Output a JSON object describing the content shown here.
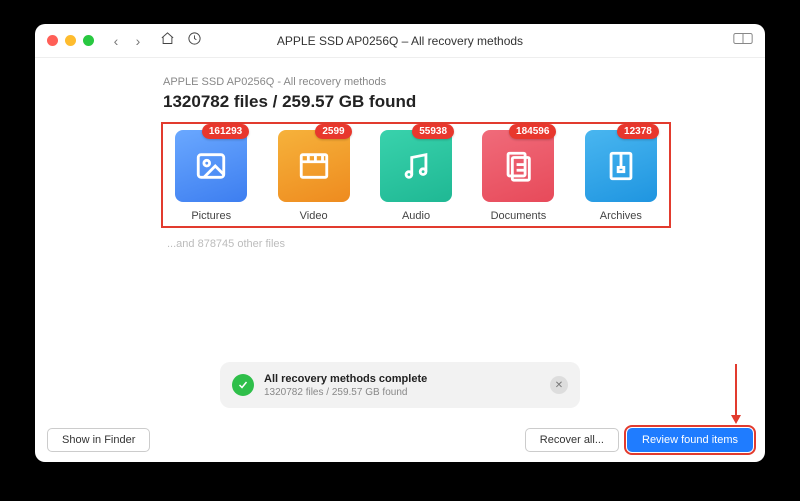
{
  "window": {
    "title": "APPLE SSD AP0256Q – All recovery methods"
  },
  "breadcrumb": "APPLE SSD AP0256Q - All recovery methods",
  "headline": "1320782 files / 259.57 GB found",
  "categories": [
    {
      "key": "pictures",
      "label": "Pictures",
      "count": "161293",
      "grad": "g-pic"
    },
    {
      "key": "video",
      "label": "Video",
      "count": "2599",
      "grad": "g-vid"
    },
    {
      "key": "audio",
      "label": "Audio",
      "count": "55938",
      "grad": "g-aud"
    },
    {
      "key": "documents",
      "label": "Documents",
      "count": "184596",
      "grad": "g-doc"
    },
    {
      "key": "archives",
      "label": "Archives",
      "count": "12378",
      "grad": "g-arc"
    }
  ],
  "other_files": "...and 878745 other files",
  "status": {
    "title": "All recovery methods complete",
    "subtitle": "1320782 files / 259.57 GB found"
  },
  "buttons": {
    "show_in_finder": "Show in Finder",
    "recover_all": "Recover all...",
    "review": "Review found items"
  }
}
